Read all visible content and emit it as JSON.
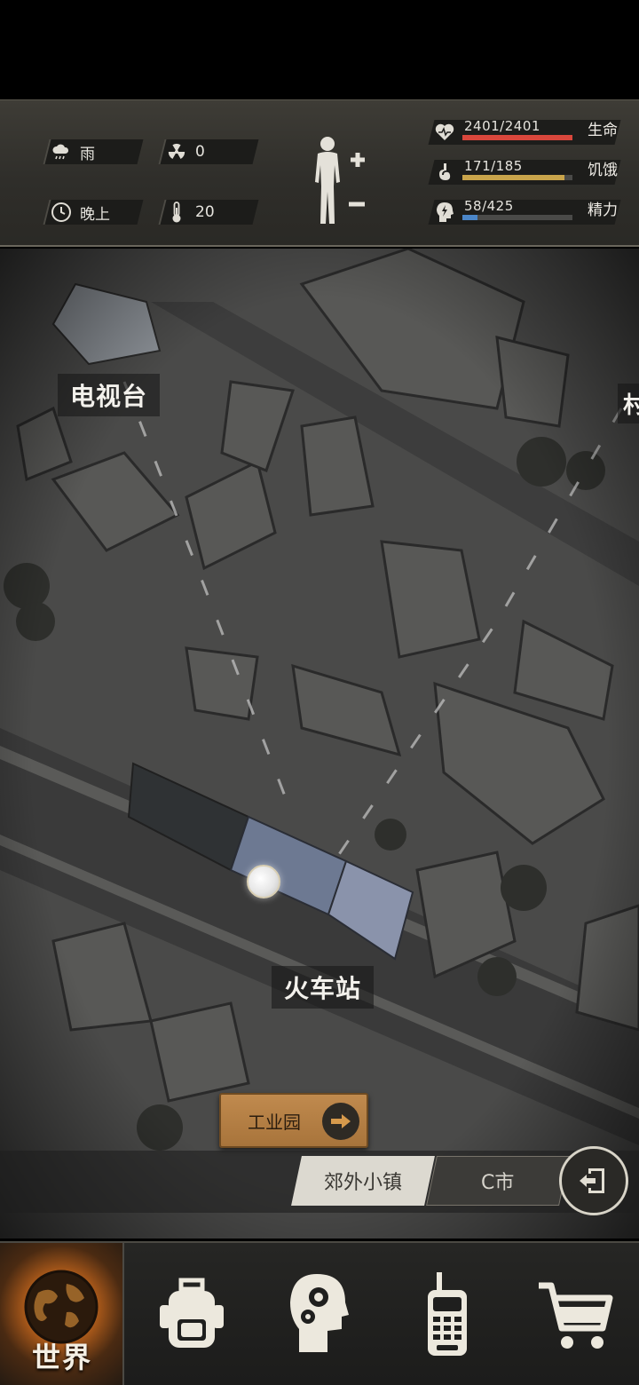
{
  "status": {
    "weather": "雨",
    "radiation": "0",
    "time_of_day": "晚上",
    "temperature": "20"
  },
  "vitals": {
    "health": {
      "value": "2401/2401",
      "label": "生命",
      "fraction": 1.0,
      "color": "#d9473c"
    },
    "hunger": {
      "value": "171/185",
      "label": "饥饿",
      "fraction": 0.924,
      "color": "#c9a44b"
    },
    "energy": {
      "value": "58/425",
      "label": "精力",
      "fraction": 0.136,
      "color": "#4b86c8"
    }
  },
  "map": {
    "labels": {
      "tv_station": "电视台",
      "train_station": "火车站",
      "edge_partial": "村"
    },
    "destination_button": "工业园"
  },
  "regions": {
    "active": "郊外小镇",
    "inactive": "C市"
  },
  "nav": {
    "world_label": "世界",
    "icons": [
      "globe-icon",
      "backpack-icon",
      "skills-head-icon",
      "radio-icon",
      "cart-icon"
    ]
  },
  "colors": {
    "accent_orange": "#c08a4e",
    "panel_bg": "#2f2e2a"
  }
}
